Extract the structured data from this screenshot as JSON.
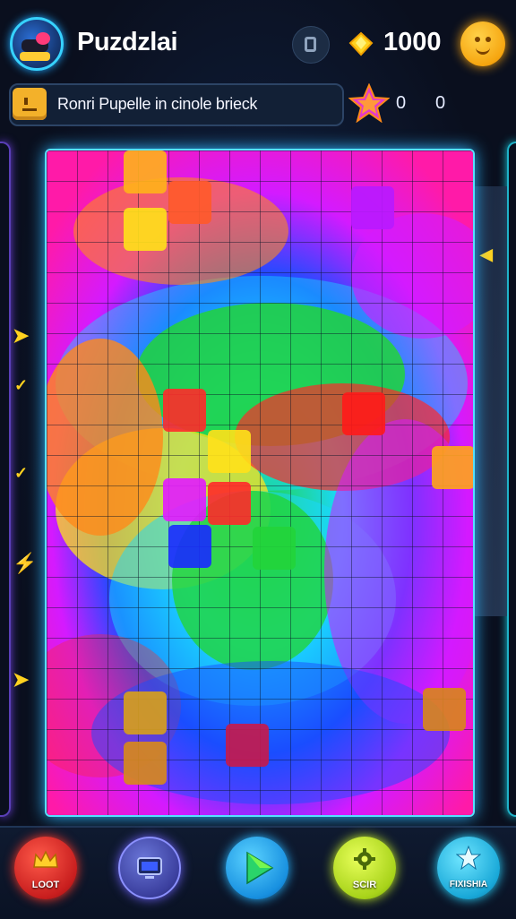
{
  "header": {
    "title": "Puzdzlai",
    "coins": "1000",
    "icons": {
      "avatar": "player-avatar",
      "pause": "pause-icon",
      "gem": "gem-icon",
      "emoji": "smiley-icon"
    }
  },
  "objective": {
    "text": "Ronri Pupelle in cinole brieck",
    "score_left": "0",
    "score_right": "0"
  },
  "board": {
    "theme_colors": [
      "#ff2a2a",
      "#ff8a1a",
      "#ffe11a",
      "#22d43a",
      "#1ad8ff",
      "#1a4dff",
      "#d41aff",
      "#ff1aa8"
    ]
  },
  "dock": {
    "buttons": [
      {
        "label": "LOOT",
        "icon": "crown-icon"
      },
      {
        "label": "",
        "icon": "tv-icon"
      },
      {
        "label": "",
        "icon": "play-icon"
      },
      {
        "label": "SCIR",
        "icon": "gear-icon"
      },
      {
        "label": "FIXISHIA",
        "icon": "star-icon"
      }
    ]
  }
}
